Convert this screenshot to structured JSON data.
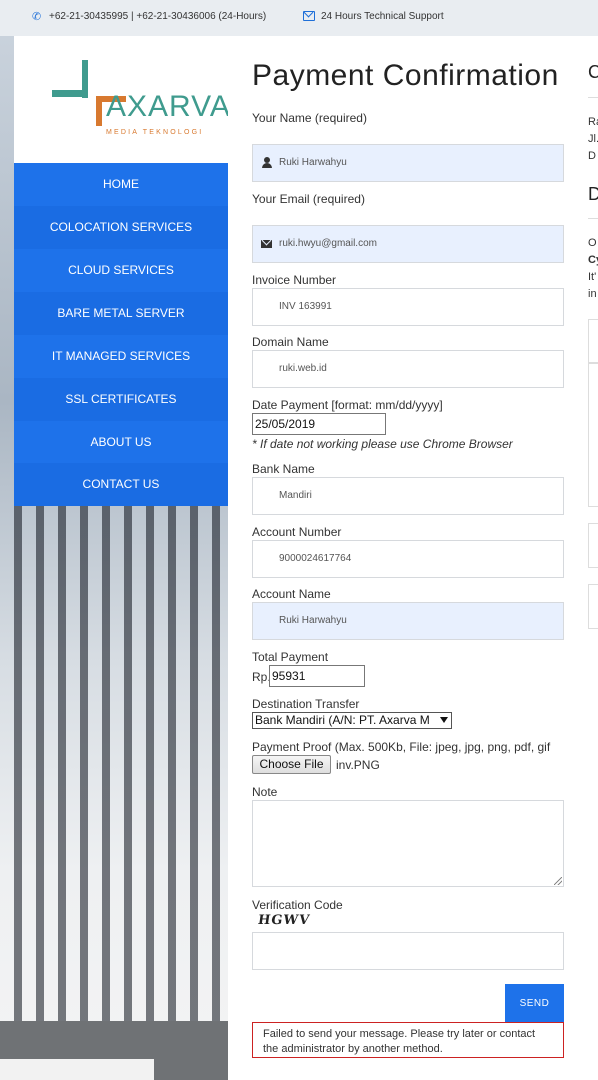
{
  "topbar": {
    "phone_icon": "phone-icon",
    "phones": "+62-21-30435995 | +62-21-30436006 (24-Hours)",
    "mail_icon": "envelope-icon",
    "support": "24 Hours Technical Support"
  },
  "logo": {
    "name": "AXARVA",
    "tagline": "MEDIA TEKNOLOGI",
    "colors": {
      "teal": "#3f9b8e",
      "orange": "#d8792f"
    }
  },
  "nav": {
    "items": [
      {
        "label": "HOME"
      },
      {
        "label": "COLOCATION SERVICES"
      },
      {
        "label": "CLOUD SERVICES"
      },
      {
        "label": "BARE METAL SERVER"
      },
      {
        "label": "IT MANAGED SERVICES"
      },
      {
        "label": "SSL CERTIFICATES"
      },
      {
        "label": "ABOUT US"
      },
      {
        "label": "CONTACT US"
      }
    ],
    "color": "#1e72ea"
  },
  "form": {
    "title": "Payment Confirmation",
    "name_label": "Your Name (required)",
    "name_value": "Ruki Harwahyu",
    "email_label": "Your Email (required)",
    "email_value": "ruki.hwyu@gmail.com",
    "invoice_label": "Invoice Number",
    "invoice_value": "INV 163991",
    "domain_label": "Domain Name",
    "domain_value": "ruki.web.id",
    "date_label": "Date Payment [format: mm/dd/yyyy]",
    "date_value": "25/05/2019",
    "date_hint": "* If date not working please use Chrome Browser",
    "bank_label": "Bank Name",
    "bank_value": "Mandiri",
    "account_number_label": "Account Number",
    "account_number_value": "9000024617764",
    "account_name_label": "Account Name",
    "account_name_value": "Ruki Harwahyu",
    "total_label": "Total Payment",
    "total_prefix": "Rp.",
    "total_value": "95931",
    "destination_label": "Destination Transfer",
    "destination_value": "Bank Mandiri (A/N: PT. Axarva M",
    "proof_label": "Payment Proof (Max. 500Kb, File: jpeg, jpg, png, pdf, gif",
    "choose_file": "Choose File",
    "file_name": "inv.PNG",
    "note_label": "Note",
    "verification_label": "Verification Code",
    "captcha_text": "HGWV",
    "send_label": "SEND",
    "error_message": "Failed to send your message. Please try later or contact the administrator by another method."
  },
  "right_column": {
    "heading_1": "C",
    "line_1": "Ra",
    "line_2": "Jl.",
    "line_3": "D",
    "heading_2": "D",
    "line_4": "O",
    "line_5": "Cy",
    "line_6": "It'",
    "line_7": "in"
  }
}
